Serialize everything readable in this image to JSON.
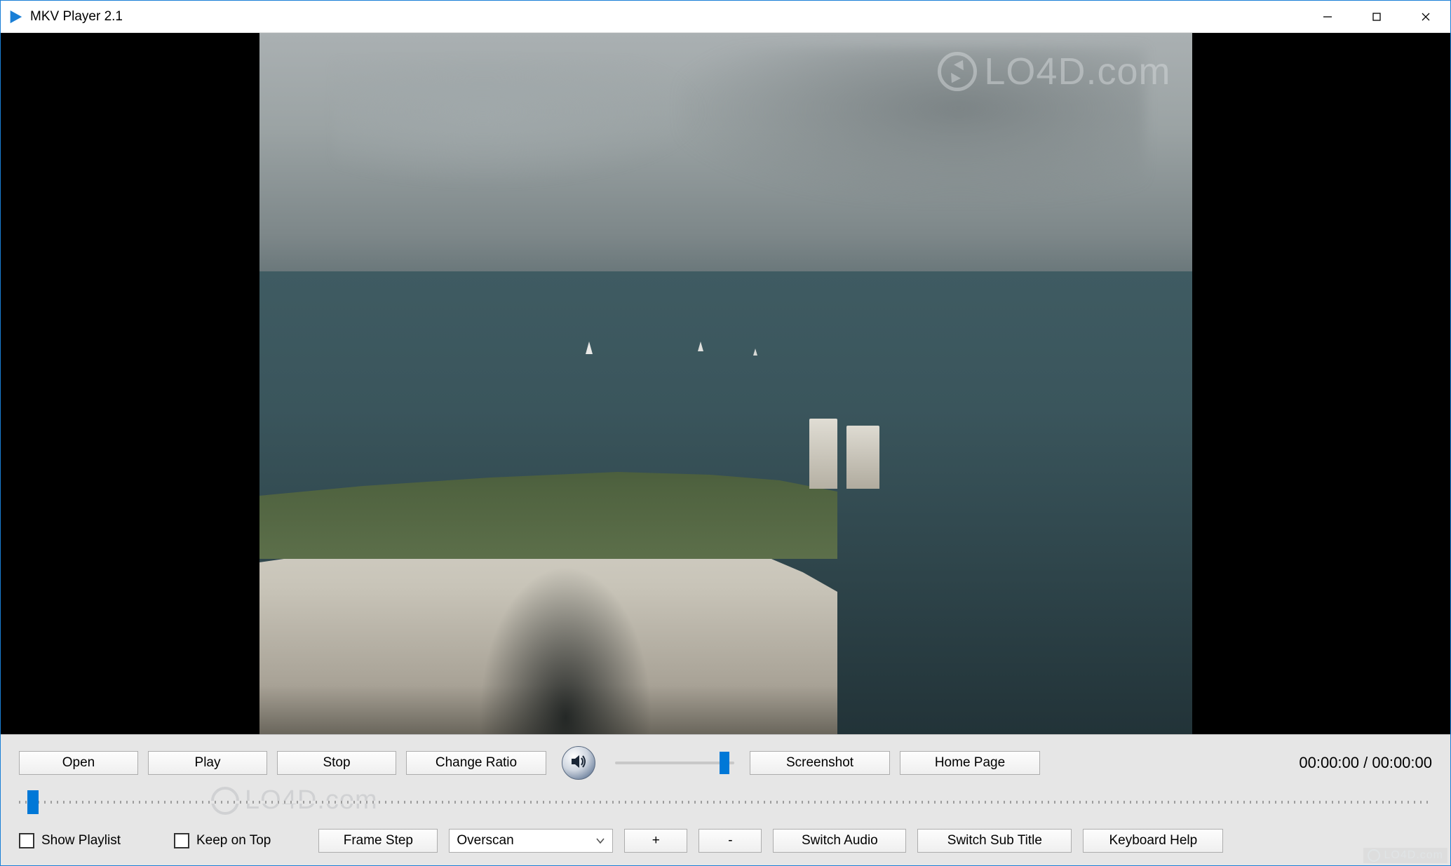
{
  "titlebar": {
    "app_title": "MKV Player 2.1"
  },
  "watermark": {
    "text_main": "LO4D",
    "text_suffix": ".com",
    "footer": "LO4D.com"
  },
  "controls": {
    "open": "Open",
    "play": "Play",
    "stop": "Stop",
    "change_ratio": "Change Ratio",
    "screenshot": "Screenshot",
    "home_page": "Home Page",
    "time_current": "00:00:00",
    "time_separator": " / ",
    "time_total": "00:00:00",
    "volume_percent": 92,
    "seek_percent": 1
  },
  "options": {
    "show_playlist_label": "Show Playlist",
    "show_playlist_checked": false,
    "keep_on_top_label": "Keep on Top",
    "keep_on_top_checked": false,
    "frame_step": "Frame Step",
    "overscan_selected": "Overscan",
    "plus": "+",
    "minus": "-",
    "switch_audio": "Switch Audio",
    "switch_subtitle": "Switch Sub Title",
    "keyboard_help": "Keyboard Help"
  }
}
